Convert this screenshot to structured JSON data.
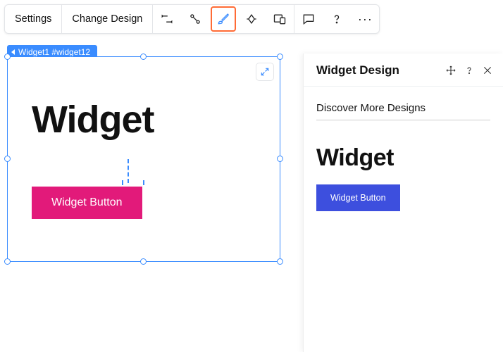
{
  "toolbar": {
    "settings_label": "Settings",
    "change_design_label": "Change Design"
  },
  "breadcrumb": {
    "label": "Widget1 #widget12"
  },
  "canvas": {
    "title": "Widget",
    "button_label": "Widget Button",
    "button_bg": "#e21a7a"
  },
  "panel": {
    "title": "Widget Design",
    "discover_label": "Discover More Designs",
    "preview": {
      "title": "Widget",
      "button_label": "Widget Button",
      "button_bg": "#3d4fde"
    }
  }
}
